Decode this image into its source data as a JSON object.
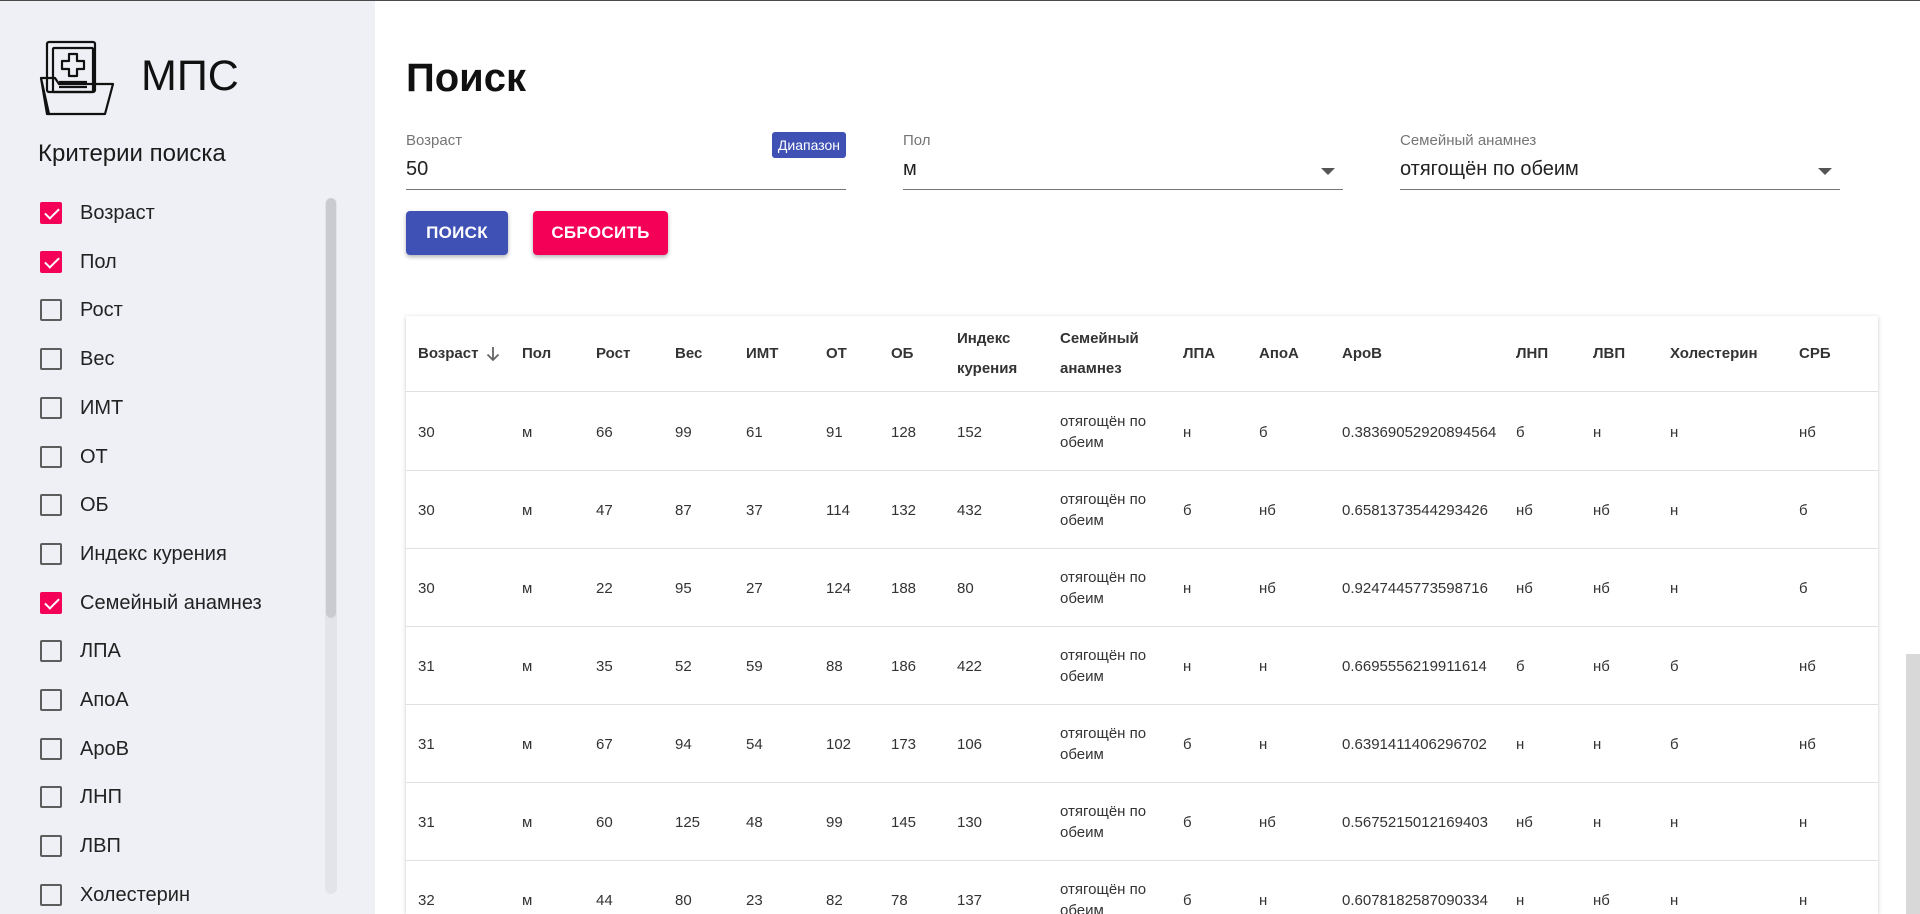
{
  "app": {
    "name": "МПС"
  },
  "sidebar": {
    "title": "Критерии поиска",
    "criteria": [
      {
        "label": "Возраст",
        "checked": true
      },
      {
        "label": "Пол",
        "checked": true
      },
      {
        "label": "Рост",
        "checked": false
      },
      {
        "label": "Вес",
        "checked": false
      },
      {
        "label": "ИМТ",
        "checked": false
      },
      {
        "label": "ОТ",
        "checked": false
      },
      {
        "label": "ОБ",
        "checked": false
      },
      {
        "label": "Индекс курения",
        "checked": false
      },
      {
        "label": "Семейный анамнез",
        "checked": true
      },
      {
        "label": "ЛПА",
        "checked": false
      },
      {
        "label": "АпоА",
        "checked": false
      },
      {
        "label": "АроВ",
        "checked": false
      },
      {
        "label": "ЛНП",
        "checked": false
      },
      {
        "label": "ЛВП",
        "checked": false
      },
      {
        "label": "Холестерин",
        "checked": false
      }
    ]
  },
  "main": {
    "title": "Поиск",
    "fields": {
      "age": {
        "label": "Возраст",
        "value": "50",
        "chip": "Диапазон"
      },
      "sex": {
        "label": "Пол",
        "value": "м"
      },
      "family": {
        "label": "Семейный анамнез",
        "value": "отягощён по обеим"
      }
    },
    "buttons": {
      "search": "ПОИСК",
      "reset": "СБРОСИТЬ"
    }
  },
  "table": {
    "columns": [
      "Возраст",
      "Пол",
      "Рост",
      "Вес",
      "ИМТ",
      "ОТ",
      "ОБ",
      "Индекс курения",
      "Семейный анамнез",
      "ЛПА",
      "АпоА",
      "АроВ",
      "ЛНП",
      "ЛВП",
      "Холестерин",
      "СРБ"
    ],
    "rows": [
      [
        "30",
        "м",
        "66",
        "99",
        "61",
        "91",
        "128",
        "152",
        "отягощён по обеим",
        "н",
        "б",
        "0.38369052920894564",
        "б",
        "н",
        "н",
        "нб"
      ],
      [
        "30",
        "м",
        "47",
        "87",
        "37",
        "114",
        "132",
        "432",
        "отягощён по обеим",
        "б",
        "нб",
        "0.6581373544293426",
        "нб",
        "нб",
        "н",
        "б"
      ],
      [
        "30",
        "м",
        "22",
        "95",
        "27",
        "124",
        "188",
        "80",
        "отягощён по обеим",
        "н",
        "нб",
        "0.9247445773598716",
        "нб",
        "нб",
        "н",
        "б"
      ],
      [
        "31",
        "м",
        "35",
        "52",
        "59",
        "88",
        "186",
        "422",
        "отягощён по обеим",
        "н",
        "н",
        "0.6695556219911614",
        "б",
        "нб",
        "б",
        "нб"
      ],
      [
        "31",
        "м",
        "67",
        "94",
        "54",
        "102",
        "173",
        "106",
        "отягощён по обеим",
        "б",
        "н",
        "0.6391411406296702",
        "н",
        "н",
        "б",
        "нб"
      ],
      [
        "31",
        "м",
        "60",
        "125",
        "48",
        "99",
        "145",
        "130",
        "отягощён по обеим",
        "б",
        "нб",
        "0.5675215012169403",
        "нб",
        "н",
        "н",
        "н"
      ],
      [
        "32",
        "м",
        "44",
        "80",
        "23",
        "82",
        "78",
        "137",
        "отягощён по обеим",
        "б",
        "н",
        "0.6078182587090334",
        "н",
        "нб",
        "н",
        "н"
      ]
    ]
  }
}
